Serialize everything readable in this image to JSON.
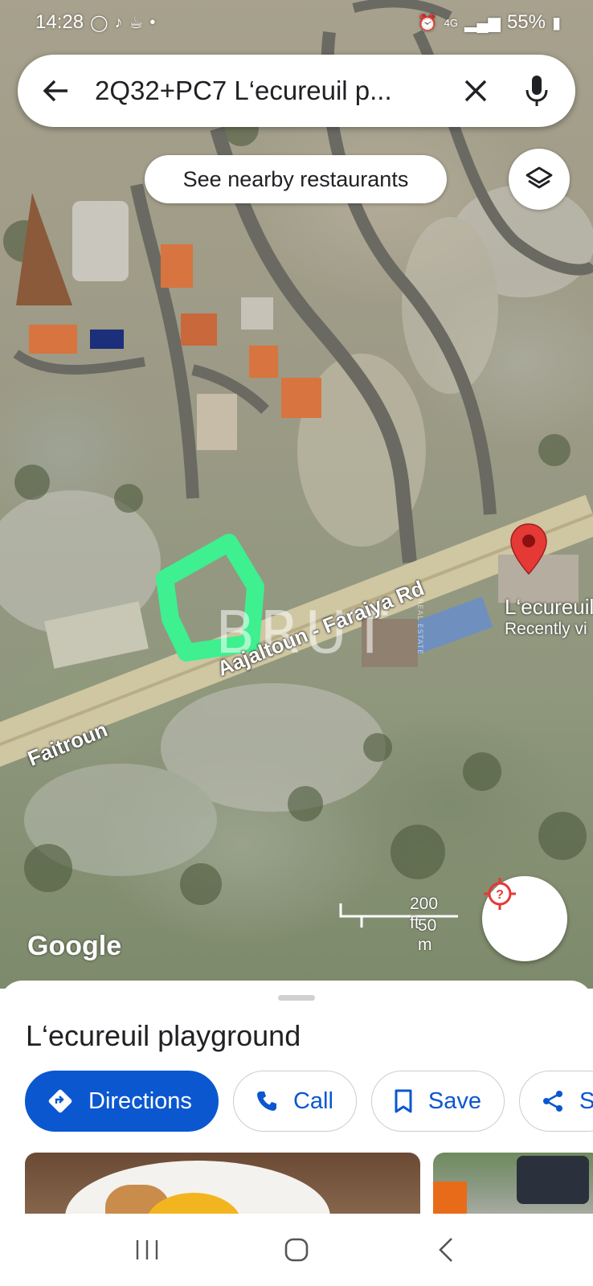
{
  "status_bar": {
    "time": "14:28",
    "network": "4G",
    "battery": "55%",
    "icons": [
      "whatsapp-icon",
      "tiktok-icon",
      "cup-icon",
      "dot-icon",
      "alarm-icon",
      "signal-icon",
      "battery-icon"
    ]
  },
  "search": {
    "query": "2Q32+PC7 L‘ecureuil p...",
    "icons": [
      "back-arrow-icon",
      "close-icon",
      "microphone-icon"
    ]
  },
  "map": {
    "nearby_chip": "See nearby restaurants",
    "road_label_main": "Aajaltoun - Faraiya Rd",
    "road_label_west": "Faitroun",
    "place_name": "L‘ecureuil",
    "place_sub": "Recently vi",
    "watermark": "BRUT",
    "watermark_sub": "REAL ESTATE",
    "scale_ft": "200 ft",
    "scale_m": "50 m",
    "logo": "Google",
    "highlight_color": "#3ef08f",
    "pin_color": "#e53935"
  },
  "sheet": {
    "title": "L‘ecureuil playground",
    "actions": [
      {
        "label": "Directions",
        "icon": "directions-icon"
      },
      {
        "label": "Call",
        "icon": "phone-icon"
      },
      {
        "label": "Save",
        "icon": "bookmark-icon"
      },
      {
        "label": "S",
        "icon": "share-icon"
      }
    ],
    "accent_color": "#0b57d0"
  },
  "nav": {
    "icons": [
      "recent-apps-icon",
      "home-icon",
      "back-icon"
    ]
  }
}
